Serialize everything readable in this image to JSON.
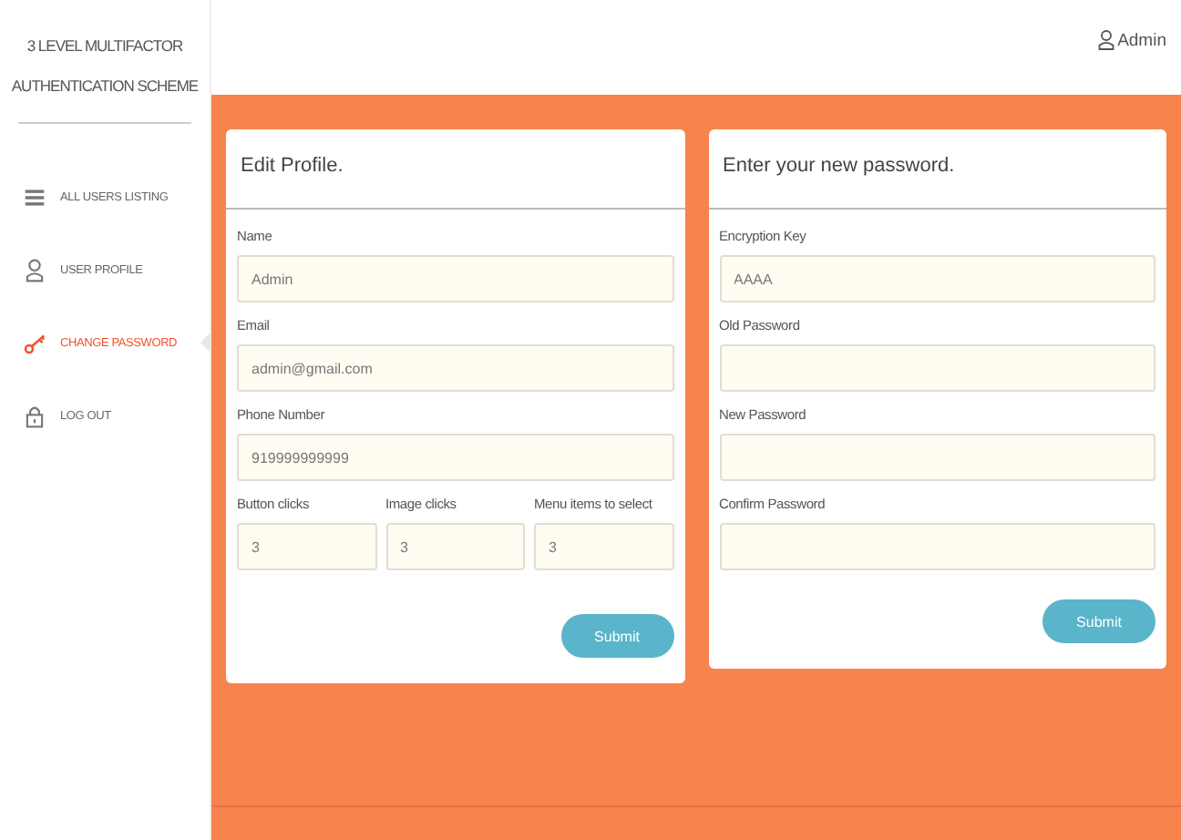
{
  "sidebar": {
    "title_lines": [
      "3 LEVEL MULTIFACTOR",
      "AUTHENTICATION SCHEME"
    ],
    "items": [
      {
        "label": "ALL USERS LISTING",
        "kind": "list",
        "selected": false
      },
      {
        "label": "USER PROFILE",
        "kind": "user",
        "selected": false
      },
      {
        "label": "CHANGE PASSWORD",
        "kind": "key",
        "selected": true
      },
      {
        "label": "LOG OUT",
        "kind": "lock",
        "selected": false
      }
    ]
  },
  "header": {
    "user": "Admin"
  },
  "profile_card": {
    "title": "Edit Profile.",
    "fields": [
      {
        "label": "Name",
        "value": "Admin"
      },
      {
        "label": "Email",
        "value": "admin@gmail.com"
      },
      {
        "label": "Phone Number",
        "value": "919999999999"
      }
    ],
    "inline_fields": [
      {
        "label": "Button clicks",
        "value": "3"
      },
      {
        "label": "Image clicks",
        "value": "3"
      },
      {
        "label": "Menu items to select",
        "value": "3"
      }
    ],
    "button": "Submit"
  },
  "password_card": {
    "title": "Enter your new password.",
    "fields": [
      {
        "label": "Encryption Key",
        "value": "AAAA"
      },
      {
        "label": "Old Password"
      },
      {
        "label": "New Password"
      },
      {
        "label": "Confirm Password"
      }
    ],
    "button": "Submit"
  }
}
